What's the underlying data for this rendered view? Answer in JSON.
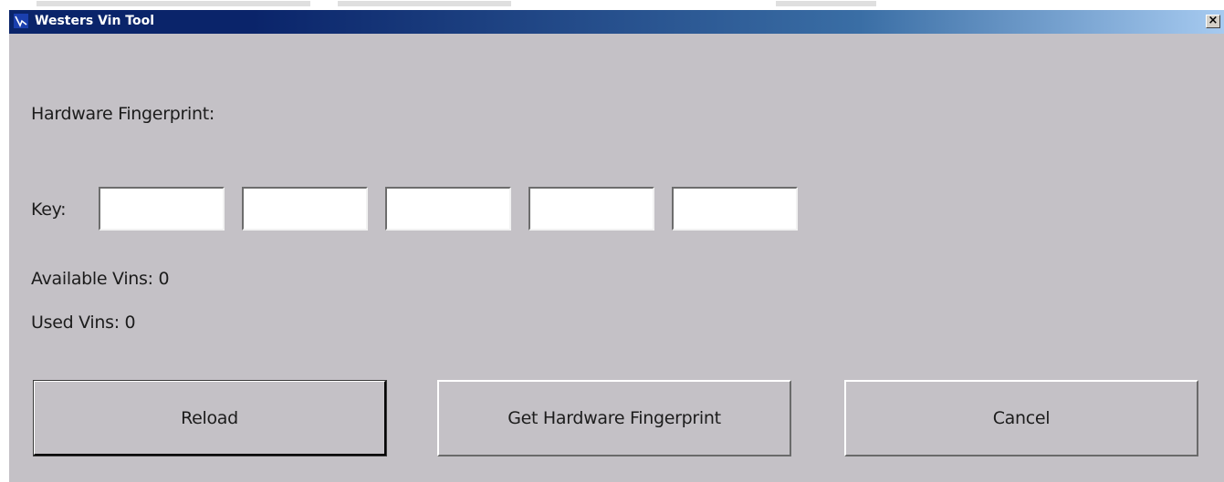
{
  "window": {
    "title": "Westers Vin Tool",
    "close_glyph": "×",
    "icon": "app-icon"
  },
  "labels": {
    "hardware_fingerprint": "Hardware Fingerprint:",
    "key": "Key:",
    "available_vins": "Available Vins:",
    "available_vins_value": "0",
    "used_vins": "Used Vins:",
    "used_vins_value": "0"
  },
  "key_fields": [
    {
      "value": ""
    },
    {
      "value": ""
    },
    {
      "value": ""
    },
    {
      "value": ""
    },
    {
      "value": ""
    }
  ],
  "buttons": {
    "reload": "Reload",
    "get_fingerprint": "Get Hardware Fingerprint",
    "cancel": "Cancel"
  },
  "colors": {
    "titlebar_start": "#0a246a",
    "titlebar_end": "#a6caf0",
    "window_bg": "#c4c1c6"
  }
}
